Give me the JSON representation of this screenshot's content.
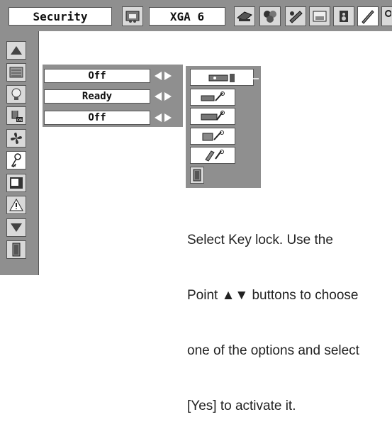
{
  "top_bar": {
    "menu_title": "Security",
    "source_label": "XGA 6",
    "icons": [
      "pc-adjust-icon",
      "image-select-icon",
      "image-adjust-icon",
      "screen-icon",
      "sound-icon",
      "setting-icon",
      "key-lock-icon"
    ]
  },
  "left_menu": {
    "icons": [
      "up-arrow-icon",
      "keypad-icon",
      "lamp-icon",
      "on-start-icon",
      "fan-icon",
      "key-icon",
      "screen-icon",
      "warning-icon",
      "down-arrow-icon",
      "exit-icon"
    ]
  },
  "options": [
    {
      "value": "Off"
    },
    {
      "value": "Ready"
    },
    {
      "value": "Off"
    }
  ],
  "key_lock_menu": {
    "items": [
      "key-lock-off-icon",
      "key-lock-remote-icon",
      "key-lock-projector-icon",
      "key-lock-both-icon",
      "key-lock-all-icon",
      "exit-icon"
    ]
  },
  "instructions": {
    "line1": "Select Key lock. Use the",
    "line2": "Point ▲▼ buttons to choose",
    "line3": "one of the options and select",
    "line4": "[Yes] to activate it."
  }
}
